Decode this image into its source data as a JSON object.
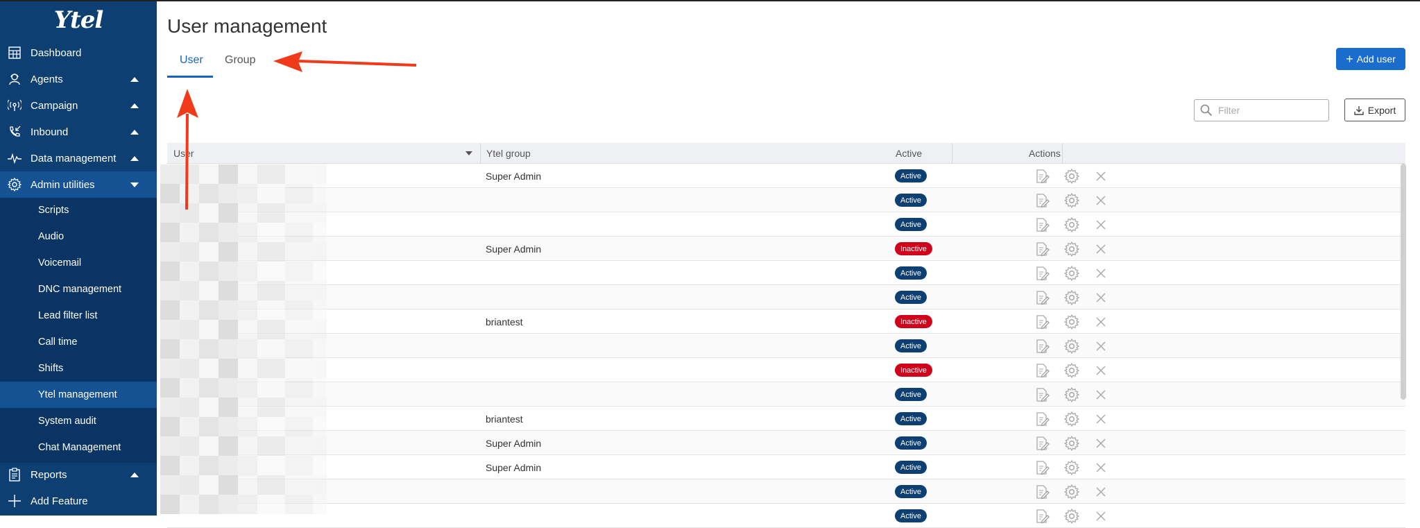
{
  "app": {
    "logo": "Ytel"
  },
  "sidebar": {
    "items": [
      {
        "label": "Dashboard",
        "icon": "dashboard-icon",
        "caret": ""
      },
      {
        "label": "Agents",
        "icon": "agent-icon",
        "caret": "up"
      },
      {
        "label": "Campaign",
        "icon": "broadcast-icon",
        "caret": "up"
      },
      {
        "label": "Inbound",
        "icon": "phone-inbound-icon",
        "caret": "up"
      },
      {
        "label": "Data management",
        "icon": "pulse-icon",
        "caret": "up"
      },
      {
        "label": "Admin utilities",
        "icon": "gear-icon",
        "caret": "down"
      }
    ],
    "subitems": [
      "Scripts",
      "Audio",
      "Voicemail",
      "DNC management",
      "Lead filter list",
      "Call time",
      "Shifts",
      "Ytel management",
      "System audit",
      "Chat Management"
    ],
    "current_subitem": "Ytel management",
    "bottom_items": [
      {
        "label": "Reports",
        "icon": "report-icon",
        "caret": "up"
      },
      {
        "label": "Add Feature",
        "icon": "plus-icon",
        "caret": ""
      }
    ]
  },
  "page": {
    "title": "User management",
    "tabs": [
      {
        "label": "User",
        "selected": true
      },
      {
        "label": "Group",
        "selected": false
      }
    ],
    "add_user_label": "Add user",
    "filter_placeholder": "Filter",
    "export_label": "Export"
  },
  "table": {
    "columns": [
      "User",
      "Ytel group",
      "Active",
      "Actions"
    ],
    "rows": [
      {
        "group": "Super Admin",
        "status": "Active"
      },
      {
        "group": "",
        "status": "Active"
      },
      {
        "group": "",
        "status": "Active"
      },
      {
        "group": "Super Admin",
        "status": "Inactive"
      },
      {
        "group": "",
        "status": "Active"
      },
      {
        "group": "",
        "status": "Active"
      },
      {
        "group": "briantest",
        "status": "Inactive"
      },
      {
        "group": "",
        "status": "Active"
      },
      {
        "group": "",
        "status": "Inactive"
      },
      {
        "group": "",
        "status": "Active"
      },
      {
        "group": "briantest",
        "status": "Active"
      },
      {
        "group": "Super Admin",
        "status": "Active"
      },
      {
        "group": "Super Admin",
        "status": "Active"
      },
      {
        "group": "",
        "status": "Active"
      },
      {
        "group": "",
        "status": "Active"
      }
    ],
    "action_icons": [
      "edit-icon",
      "gear-icon",
      "close-icon"
    ]
  },
  "colors": {
    "sidebar_bg": "#0d3f73",
    "accent": "#1a6dcc",
    "active_badge": "#0d3f73",
    "inactive_badge": "#d0021b",
    "annotation_arrow": "#f03a1a"
  }
}
